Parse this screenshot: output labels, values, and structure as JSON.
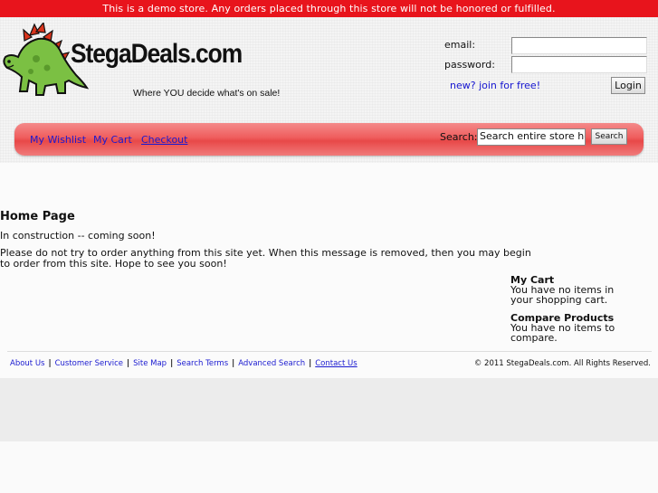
{
  "demo_notice": "This is a demo store. Any orders placed through this store will not be honored or fulfilled.",
  "header": {
    "logo_text": "StegaDeals.com",
    "tagline": "Where YOU decide what's on sale!",
    "login": {
      "email_label": "email:",
      "email_value": "",
      "password_label": "password:",
      "password_value": "",
      "join_link": "new? join for free!",
      "login_button": "Login"
    }
  },
  "nav": {
    "links": [
      "My Wishlist",
      "My Cart",
      "Checkout"
    ],
    "search_label": "Search:",
    "search_placeholder": "Search entire store here...",
    "search_button": "Search"
  },
  "main": {
    "title": "Home Page",
    "line1": "In construction -- coming soon!",
    "line2": "Please do not try to order anything from this site yet. When this message is removed, then you may begin to order from this site. Hope to see you soon!"
  },
  "sidebar": {
    "cart_title": "My Cart",
    "cart_text": "You have no items in your shopping cart.",
    "compare_title": "Compare Products",
    "compare_text": "You have no items to compare."
  },
  "footer": {
    "links": [
      "About Us",
      "Customer Service",
      "Site Map",
      "Search Terms",
      "Advanced Search",
      "Contact Us"
    ],
    "copyright": "© 2011 StegaDeals.com. All Rights Reserved."
  },
  "colors": {
    "demo_bar": "#e8141c",
    "nav_bar": "#ef5d5d",
    "link": "#1a1ad0",
    "dino_green": "#7bc043",
    "dino_spikes": "#d9341c"
  }
}
